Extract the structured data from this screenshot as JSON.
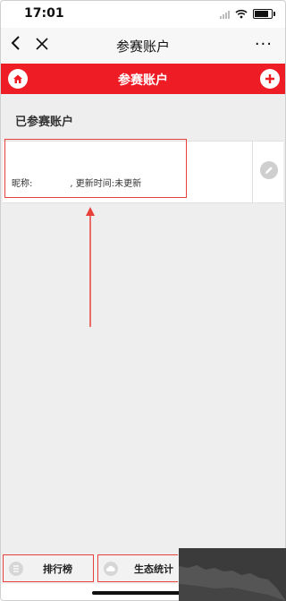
{
  "status": {
    "time": "17:01"
  },
  "nav": {
    "title": "参赛账户",
    "more": "···"
  },
  "header": {
    "title": "参赛账户"
  },
  "section": {
    "title": "已参赛账户"
  },
  "account": {
    "nickname_label": "昵称:",
    "nickname_value": "",
    "update_text": ", 更新时间:未更新"
  },
  "tabs": [
    {
      "label": "排行榜"
    },
    {
      "label": "生态统计"
    }
  ],
  "colors": {
    "accent": "#ee1c25",
    "annotation": "#e8403b"
  }
}
